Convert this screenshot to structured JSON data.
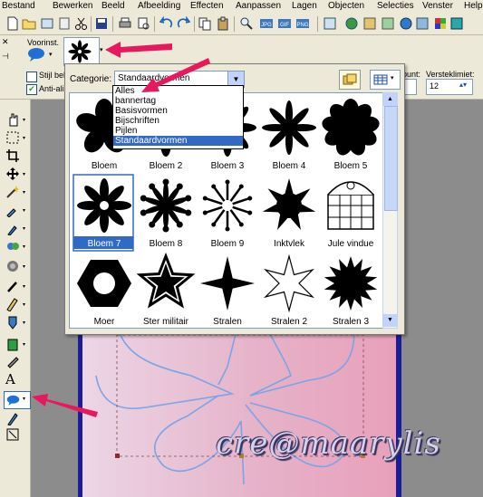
{
  "menu": [
    "Bestand",
    "Bewerken",
    "Beeld",
    "Afbeelding",
    "Effecten",
    "Aanpassen",
    "Lagen",
    "Objecten",
    "Selecties",
    "Venster",
    "Help"
  ],
  "options_bar": {
    "preset_label": "Voorinst.",
    "style_checkbox_label": "Stijl beh",
    "antialias_label": "Anti-alia",
    "antialias_checked": true,
    "style_checked": false,
    "point_label": "punt:",
    "stretch_label": "Versteklimiet:",
    "stretch_value": "12"
  },
  "picker": {
    "category_label": "Categorie:",
    "category_value": "Standaardvormen",
    "category_options": [
      "Alles",
      "bannertag",
      "Basisvormen",
      "Bijschriften",
      "Pijlen",
      "Standaardvormen"
    ],
    "selected_option_index": 5,
    "selected_shape": "Bloem 7",
    "shapes": [
      [
        "Bloem",
        "Bloem 2",
        "Bloem 3",
        "Bloem 4",
        "Bloem 5"
      ],
      [
        "Bloem 7",
        "Bloem 8",
        "Bloem 9",
        "Inktvlek",
        "Jule vindue"
      ],
      [
        "Moer",
        "Ster militair",
        "Stralen",
        "Stralen 2",
        "Stralen 3"
      ]
    ]
  },
  "watermark": "cre@maarylis",
  "colors": {
    "arrow": "#e8185c",
    "selection": "#316ac5",
    "frame": "#1c1c9a"
  }
}
